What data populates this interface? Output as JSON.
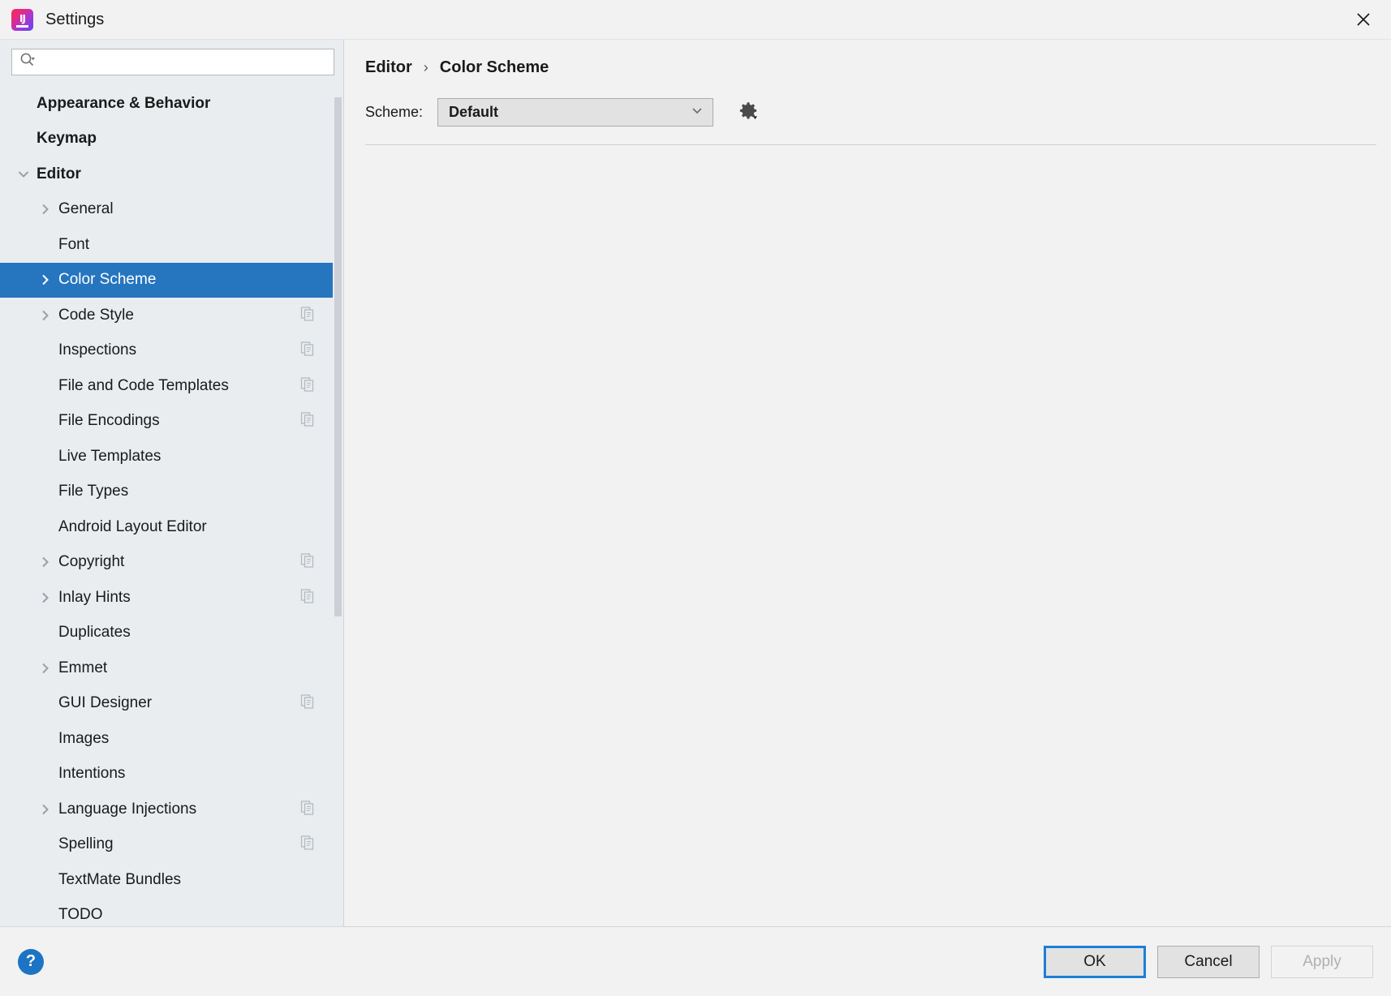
{
  "window": {
    "title": "Settings",
    "app_icon": "intellij-idea-logo",
    "close_icon": "close-icon"
  },
  "search": {
    "value": "",
    "placeholder": "",
    "icon": "search-icon"
  },
  "sidebar": {
    "items": [
      {
        "label": "Appearance & Behavior",
        "level": 0,
        "chevron": "none",
        "selected": false,
        "copy_icon": false
      },
      {
        "label": "Keymap",
        "level": 0,
        "chevron": "none",
        "selected": false,
        "copy_icon": false
      },
      {
        "label": "Editor",
        "level": 0,
        "chevron": "down",
        "selected": false,
        "copy_icon": false
      },
      {
        "label": "General",
        "level": 1,
        "chevron": "right",
        "selected": false,
        "copy_icon": false
      },
      {
        "label": "Font",
        "level": 1,
        "chevron": "none",
        "selected": false,
        "copy_icon": false
      },
      {
        "label": "Color Scheme",
        "level": 1,
        "chevron": "right",
        "selected": true,
        "copy_icon": false
      },
      {
        "label": "Code Style",
        "level": 1,
        "chevron": "right",
        "selected": false,
        "copy_icon": true
      },
      {
        "label": "Inspections",
        "level": 1,
        "chevron": "none",
        "selected": false,
        "copy_icon": true
      },
      {
        "label": "File and Code Templates",
        "level": 1,
        "chevron": "none",
        "selected": false,
        "copy_icon": true
      },
      {
        "label": "File Encodings",
        "level": 1,
        "chevron": "none",
        "selected": false,
        "copy_icon": true
      },
      {
        "label": "Live Templates",
        "level": 1,
        "chevron": "none",
        "selected": false,
        "copy_icon": false
      },
      {
        "label": "File Types",
        "level": 1,
        "chevron": "none",
        "selected": false,
        "copy_icon": false
      },
      {
        "label": "Android Layout Editor",
        "level": 1,
        "chevron": "none",
        "selected": false,
        "copy_icon": false
      },
      {
        "label": "Copyright",
        "level": 1,
        "chevron": "right",
        "selected": false,
        "copy_icon": true
      },
      {
        "label": "Inlay Hints",
        "level": 1,
        "chevron": "right",
        "selected": false,
        "copy_icon": true
      },
      {
        "label": "Duplicates",
        "level": 1,
        "chevron": "none",
        "selected": false,
        "copy_icon": false
      },
      {
        "label": "Emmet",
        "level": 1,
        "chevron": "right",
        "selected": false,
        "copy_icon": false
      },
      {
        "label": "GUI Designer",
        "level": 1,
        "chevron": "none",
        "selected": false,
        "copy_icon": true
      },
      {
        "label": "Images",
        "level": 1,
        "chevron": "none",
        "selected": false,
        "copy_icon": false
      },
      {
        "label": "Intentions",
        "level": 1,
        "chevron": "none",
        "selected": false,
        "copy_icon": false
      },
      {
        "label": "Language Injections",
        "level": 1,
        "chevron": "right",
        "selected": false,
        "copy_icon": true
      },
      {
        "label": "Spelling",
        "level": 1,
        "chevron": "none",
        "selected": false,
        "copy_icon": true
      },
      {
        "label": "TextMate Bundles",
        "level": 1,
        "chevron": "none",
        "selected": false,
        "copy_icon": false
      },
      {
        "label": "TODO",
        "level": 1,
        "chevron": "none",
        "selected": false,
        "copy_icon": false
      }
    ]
  },
  "breadcrumb": {
    "parent": "Editor",
    "separator": "›",
    "current": "Color Scheme"
  },
  "scheme": {
    "label": "Scheme:",
    "selected": "Default",
    "options": [
      "Default"
    ],
    "gear_icon": "gear-icon",
    "dropdown_icon": "chevron-down-icon"
  },
  "footer": {
    "help_label": "?",
    "ok_label": "OK",
    "cancel_label": "Cancel",
    "apply_label": "Apply",
    "apply_disabled": true
  },
  "colors": {
    "selection_blue": "#2675bf",
    "focus_blue": "#1d7fd6",
    "help_blue": "#1d74c4",
    "sidebar_bg": "#e9edf0",
    "main_bg": "#f2f2f2"
  }
}
